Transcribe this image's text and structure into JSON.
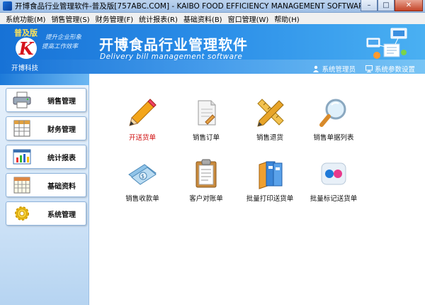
{
  "window": {
    "title": "开博食品行业管理软件-普及版[757ABC.COM] - KAIBO FOOD EFFICIENCY MANAGEMENT SOFTWARE - V1.50"
  },
  "menu": [
    {
      "label": "系统功能(M)"
    },
    {
      "label": "销售管理(S)"
    },
    {
      "label": "财务管理(F)"
    },
    {
      "label": "统计报表(R)"
    },
    {
      "label": "基础资料(B)"
    },
    {
      "label": "窗口管理(W)"
    },
    {
      "label": "帮助(H)"
    }
  ],
  "banner": {
    "edition": "普及版",
    "logo_letter": "K",
    "company": "开博科技",
    "slogan_line1": "提升企业形象",
    "slogan_line2": "提高工作效率",
    "app_name": "开博食品行业管理软件",
    "app_subtitle": "Delivery bill management software",
    "links": [
      {
        "label": "系统管理员",
        "icon": "user-icon"
      },
      {
        "label": "系统参数设置",
        "icon": "monitor-icon"
      }
    ]
  },
  "sidebar": {
    "items": [
      {
        "label": "销售管理",
        "icon": "printer-icon"
      },
      {
        "label": "财务管理",
        "icon": "spreadsheet-icon"
      },
      {
        "label": "统计报表",
        "icon": "chart-report-icon"
      },
      {
        "label": "基础资料",
        "icon": "calendar-grid-icon"
      },
      {
        "label": "系统管理",
        "icon": "gear-icon"
      }
    ]
  },
  "functions": [
    {
      "label": "开送货单",
      "icon": "pencil-icon",
      "active": true
    },
    {
      "label": "销售订单",
      "icon": "document-edit-icon"
    },
    {
      "label": "销售退货",
      "icon": "ruler-pencil-icon"
    },
    {
      "label": "销售单据列表",
      "icon": "magnifier-icon"
    },
    {
      "label": "销售收款单",
      "icon": "money-icon"
    },
    {
      "label": "客户对账单",
      "icon": "clipboard-icon"
    },
    {
      "label": "批量打印送货单",
      "icon": "binders-icon"
    },
    {
      "label": "批量标记送货单",
      "icon": "flickr-dots-icon"
    }
  ],
  "colors": {
    "banner_blue": "#1772d6",
    "active_label": "#d01010"
  }
}
